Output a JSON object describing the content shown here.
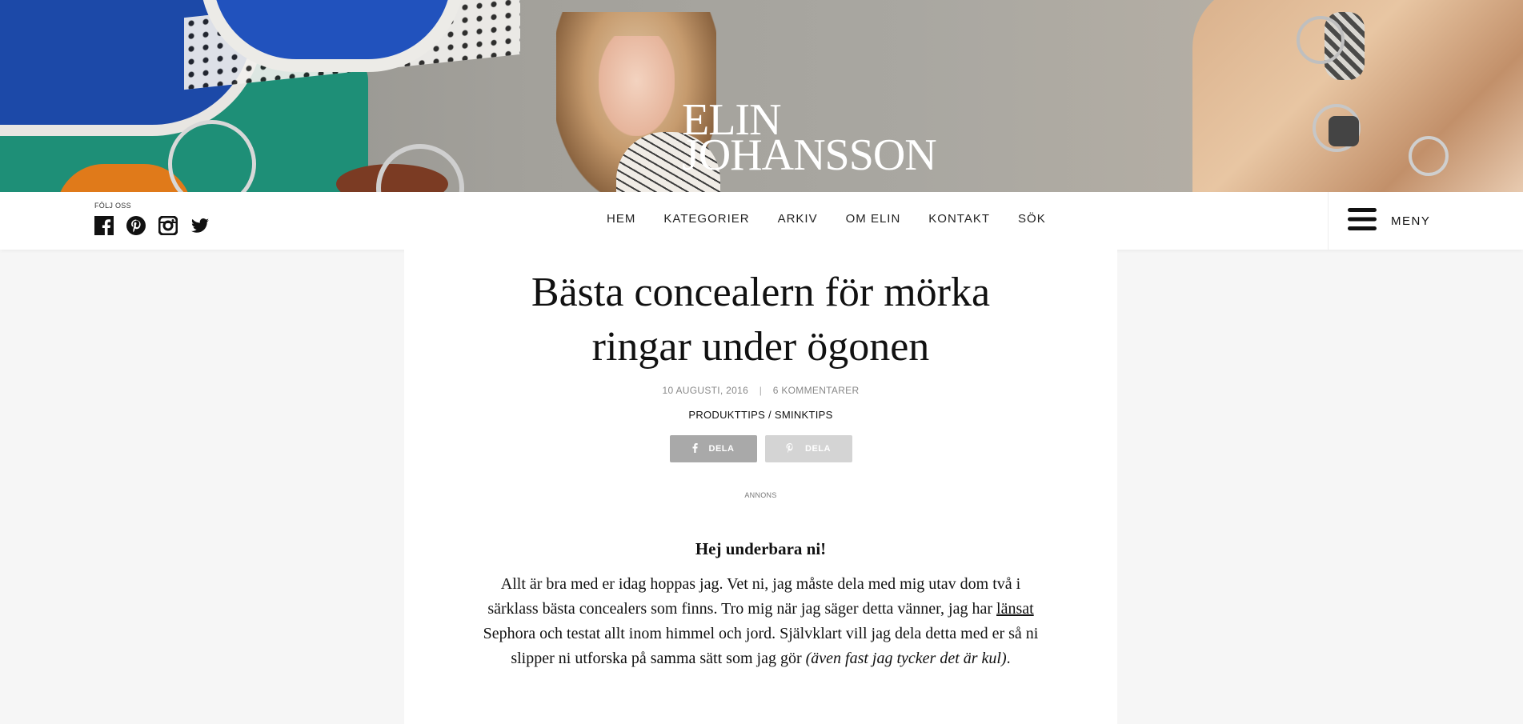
{
  "header": {
    "logo_line1": "ELIN",
    "logo_line2": "JOHANSSON"
  },
  "navbar": {
    "follow_label": "FÖLJ OSS",
    "social_icons": [
      "facebook-icon",
      "pinterest-icon",
      "instagram-icon",
      "twitter-icon"
    ],
    "menu": [
      {
        "label": "HEM"
      },
      {
        "label": "KATEGORIER"
      },
      {
        "label": "ARKIV"
      },
      {
        "label": "OM ELIN"
      },
      {
        "label": "KONTAKT"
      },
      {
        "label": "SÖK"
      }
    ],
    "meny_label": "MENY"
  },
  "article": {
    "title": "Bästa concealern för mörka ringar under ögonen",
    "date": "10 AUGUSTI, 2016",
    "comments": "6 KOMMENTARER",
    "separator": "|",
    "categories": "PRODUKTTIPS / SMINKTIPS",
    "share_facebook": "DELA",
    "share_pinterest": "DELA",
    "annons": "ANNONS",
    "lead": "Hej underbara ni!",
    "para_part1": "Allt är bra med er idag hoppas jag. Vet ni, jag måste dela med mig utav dom två i särklass bästa concealers som finns. Tro mig när jag säger detta vänner, jag har ",
    "para_link": "länsat",
    "para_part2": " Sephora och testat allt inom himmel och jord. Självklart vill jag dela detta med er så ni slipper ni utforska på samma sätt som jag gör ",
    "para_italic": "(även fast jag tycker det är kul)",
    "para_end": "."
  },
  "colors": {
    "page_bg": "#f6f6f6",
    "share_facebook_bg": "#a9a9a9",
    "share_pinterest_bg": "#d4d4d4"
  }
}
